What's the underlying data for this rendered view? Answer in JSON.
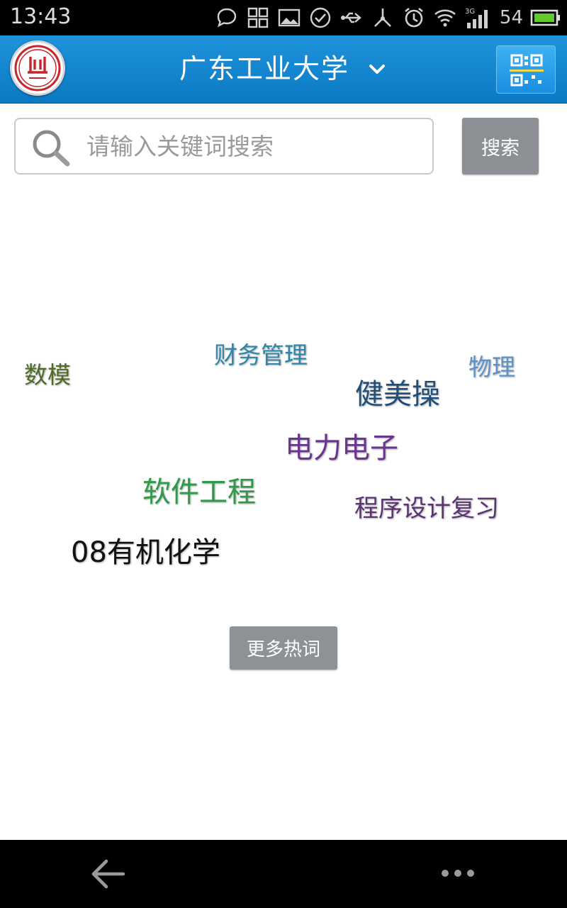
{
  "status_bar": {
    "time": "13:43",
    "signal_label": "3G",
    "battery_percent": "54",
    "icons": [
      "chat-icon",
      "grid-app-icon",
      "image-icon",
      "check-circle-icon",
      "usb-icon",
      "debug-icon",
      "alarm-icon",
      "wifi-icon",
      "signal-icon",
      "battery-icon"
    ]
  },
  "header": {
    "title": "广东工业大学",
    "logo_icon": "university-seal-icon",
    "qr_icon": "qr-scan-icon",
    "dropdown_icon": "chevron-down-icon"
  },
  "search": {
    "placeholder": "请输入关键词搜索",
    "value": "",
    "button_label": "搜索"
  },
  "hot_words": [
    {
      "text": "财务管理",
      "color": "#2f86a8"
    },
    {
      "text": "数模",
      "color": "#4e6b2a"
    },
    {
      "text": "物理",
      "color": "#5d93c6"
    },
    {
      "text": "健美操",
      "color": "#1f4e7a"
    },
    {
      "text": "电力电子",
      "color": "#6a3590"
    },
    {
      "text": "软件工程",
      "color": "#2e9a4a"
    },
    {
      "text": "程序设计复习",
      "color": "#5a3370"
    },
    {
      "text": "08有机化学",
      "color": "#111111"
    }
  ],
  "more_button_label": "更多热词",
  "nav": {
    "back_icon": "back-arrow-icon",
    "menu_icon": "more-dots-icon"
  },
  "colors": {
    "header_blue": "#1483d0",
    "button_gray": "#8c9094"
  }
}
